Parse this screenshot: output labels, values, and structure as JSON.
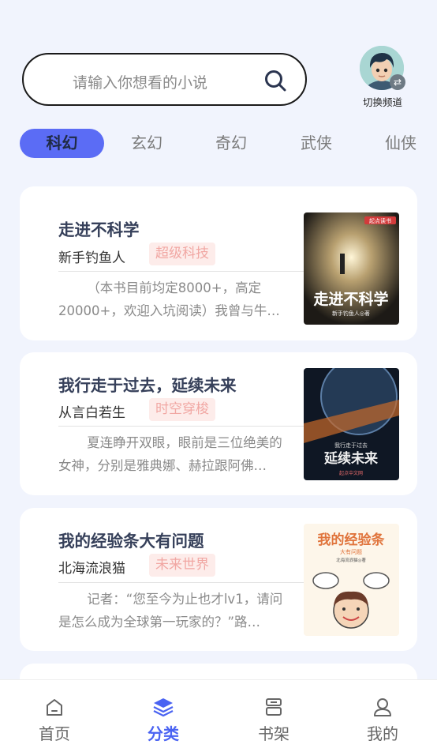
{
  "search": {
    "placeholder": "请输入你想看的小说"
  },
  "header": {
    "switch_label": "切换频道",
    "accent": "#5b6cf5"
  },
  "tabs": [
    {
      "label": "科幻",
      "active": true
    },
    {
      "label": "玄幻",
      "active": false
    },
    {
      "label": "奇幻",
      "active": false
    },
    {
      "label": "武侠",
      "active": false
    },
    {
      "label": "仙侠",
      "active": false
    }
  ],
  "books": [
    {
      "title": "走进不科学",
      "author": "新手钓鱼人",
      "tag": "超级科技",
      "description": "（本书目前均定8000+，高定20000+，欢迎入坑阅读）我曾与牛…",
      "cover_title": "走进不科学",
      "cover_author": "新手钓鱼人◎著",
      "cover_publisher": "起点读书"
    },
    {
      "title": "我行走于过去，延续未来",
      "author": "从言白若生",
      "tag": "时空穿梭",
      "description": "夏连睁开双眼，眼前是三位绝美的女神，分别是雅典娜、赫拉跟阿佛…",
      "cover_title": "延续未来",
      "cover_subtitle": "我行走于过去",
      "cover_publisher": "起点中文网"
    },
    {
      "title": "我的经验条大有问题",
      "author": "北海流浪猫",
      "tag": "未来世界",
      "description": "记者：“您至今为止也才lv1，请问是怎么成为全球第一玩家的？”路…",
      "cover_title": "我的经验条",
      "cover_subtitle": "大有问题",
      "cover_author": "北海流浪猫◎著"
    }
  ],
  "nav": [
    {
      "label": "首页",
      "icon": "home-icon",
      "active": false
    },
    {
      "label": "分类",
      "icon": "category-layers-icon",
      "active": true
    },
    {
      "label": "书架",
      "icon": "bookshelf-icon",
      "active": false
    },
    {
      "label": "我的",
      "icon": "user-icon",
      "active": false
    }
  ]
}
